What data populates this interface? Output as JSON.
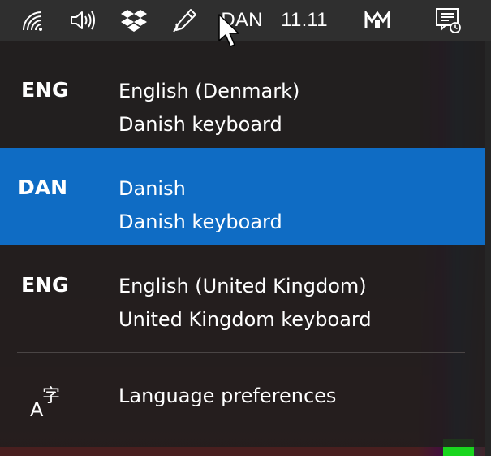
{
  "taskbar": {
    "icons": [
      "wifi-icon",
      "volume-icon",
      "dropbox-icon",
      "pen-icon",
      "app-m-icon",
      "notifications-icon"
    ],
    "input_indicator": "DAN",
    "clock": "11.11"
  },
  "language_menu": {
    "items": [
      {
        "code": "ENG",
        "name": "English (Denmark)",
        "keyboard": "Danish keyboard",
        "selected": false
      },
      {
        "code": "DAN",
        "name": "Danish",
        "keyboard": "Danish keyboard",
        "selected": true
      },
      {
        "code": "ENG",
        "name": "English (United Kingdom)",
        "keyboard": "United Kingdom keyboard",
        "selected": false
      }
    ],
    "preferences_label": "Language preferences",
    "preferences_icon": "language-icon"
  },
  "colors": {
    "selected_item": "#0f6cc4",
    "flyout_background": "#211e1e",
    "taskbar_background": "#2f2f2f",
    "text": "#ffffff"
  }
}
